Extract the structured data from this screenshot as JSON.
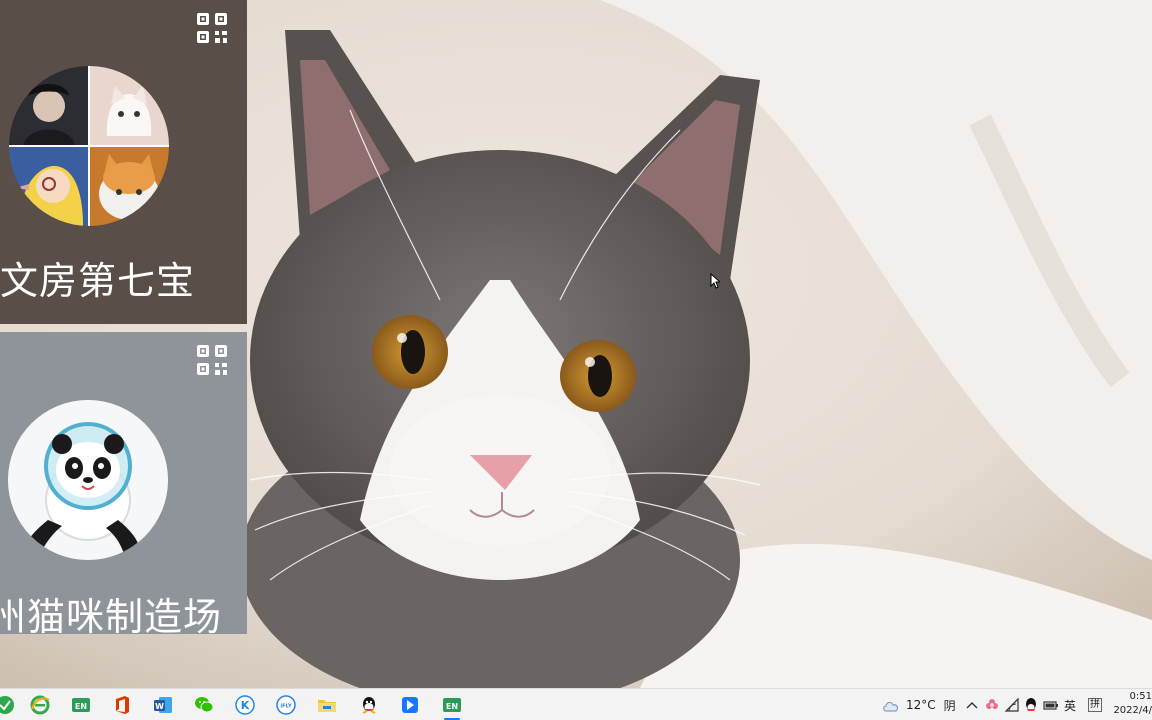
{
  "wallpaper": {
    "icon": "cat-photo"
  },
  "accounts": [
    {
      "name": "文房第七宝",
      "avatar": "collage-avatar",
      "bg_color": "#5a4e49",
      "qr_icon": "qr-code-icon"
    },
    {
      "name": "州猫咪制造场",
      "avatar": "panda-mascot-avatar",
      "bg_color": "#8e9499",
      "qr_icon": "qr-code-icon"
    }
  ],
  "taskbar": {
    "apps": [
      {
        "name": "green-app-icon",
        "color": "#2aa84a"
      },
      {
        "name": "ie-browser-icon",
        "color": "#36a852"
      },
      {
        "name": "en-app-icon",
        "label": "EN",
        "color": "#2b9b55"
      },
      {
        "name": "office-icon",
        "color": "#d83b01"
      },
      {
        "name": "word-icon",
        "label": "W",
        "color": "#2b579a"
      },
      {
        "name": "wechat-icon",
        "color": "#2dc100"
      },
      {
        "name": "k-app-icon",
        "label": "K",
        "color": "#1e88e5"
      },
      {
        "name": "ifly-icon",
        "label": "iFLY",
        "color": "#2b7de9"
      },
      {
        "name": "file-explorer-icon",
        "color": "#f3c13a"
      },
      {
        "name": "qq-icon",
        "color": "#111111"
      },
      {
        "name": "blue-app-icon",
        "color": "#1677ff"
      },
      {
        "name": "en-app-2-icon",
        "label": "EN",
        "color": "#2b9b55"
      }
    ],
    "weather": {
      "temperature": "12°C",
      "condition": "阴",
      "icon": "cloud-icon"
    },
    "tray": {
      "chevron": "^",
      "ime_language": "英",
      "ime_mode": "拼"
    },
    "clock": {
      "time": "0:51",
      "date": "2022/4/"
    }
  }
}
